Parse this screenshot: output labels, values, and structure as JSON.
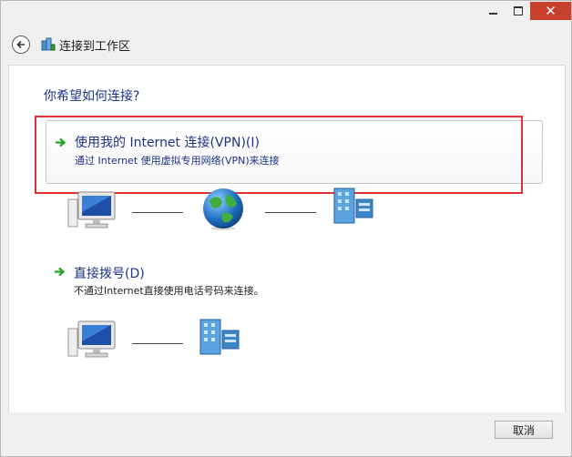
{
  "window": {
    "controls": {
      "minimize": "–",
      "maximize": "□",
      "close": "✕"
    }
  },
  "header": {
    "title": "连接到工作区",
    "back_icon": "back-arrow-icon",
    "network_icon": "network-workplace-icon"
  },
  "main": {
    "question": "你希望如何连接?",
    "options": [
      {
        "title": "使用我的 Internet 连接(VPN)(I)",
        "description": "通过 Internet 使用虚拟专用网络(VPN)来连接",
        "selected": true
      },
      {
        "title": "直接拨号(D)",
        "description": "不通过Internet直接使用电话号码来连接。",
        "selected": false
      }
    ]
  },
  "footer": {
    "cancel_label": "取消"
  },
  "colors": {
    "text_blue": "#1e3287",
    "close_red": "#c7402c",
    "highlight_red": "#e03232",
    "arrow_green": "#1fa51f"
  }
}
